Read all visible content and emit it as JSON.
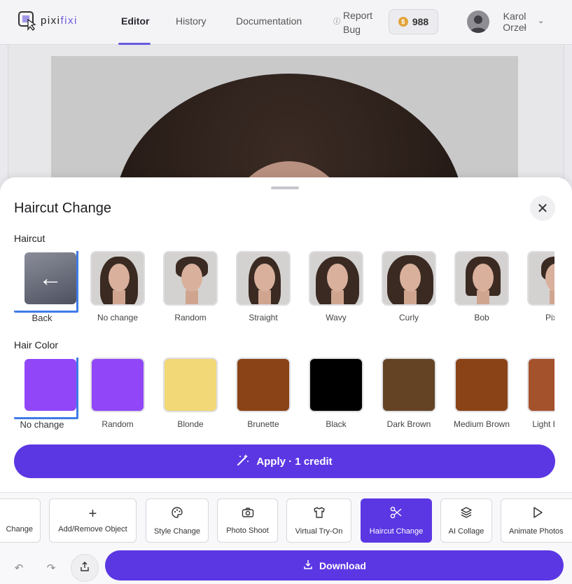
{
  "header": {
    "logo": {
      "part1": "pixi",
      "part2": "fixi"
    },
    "tabs": [
      {
        "label": "Editor",
        "active": true
      },
      {
        "label": "History",
        "active": false
      },
      {
        "label": "Documentation",
        "active": false
      }
    ],
    "report_bug": {
      "line1": "Report",
      "line2": "Bug"
    },
    "credits": "988",
    "user": {
      "first": "Karol",
      "last": "Orzeł"
    }
  },
  "sheet": {
    "title": "Haircut Change",
    "close_icon": "close-icon",
    "haircut": {
      "label": "Haircut",
      "options": [
        {
          "label": "Back",
          "icon": "arrow-left-icon",
          "selected": true
        },
        {
          "label": "No change"
        },
        {
          "label": "Random"
        },
        {
          "label": "Straight"
        },
        {
          "label": "Wavy"
        },
        {
          "label": "Curly"
        },
        {
          "label": "Bob"
        },
        {
          "label": "Pixie"
        }
      ]
    },
    "hair_color": {
      "label": "Hair Color",
      "options": [
        {
          "label": "No change",
          "color": "#9147f7",
          "selected": true
        },
        {
          "label": "Random",
          "color": "#9147f7"
        },
        {
          "label": "Blonde",
          "color": "#f2d876"
        },
        {
          "label": "Brunette",
          "color": "#8a4316"
        },
        {
          "label": "Black",
          "color": "#000000"
        },
        {
          "label": "Dark Brown",
          "color": "#634323"
        },
        {
          "label": "Medium Brown",
          "color": "#8a4316"
        },
        {
          "label": "Light Brown",
          "color": "#a4522c"
        }
      ]
    },
    "apply_label": "Apply · 1 credit"
  },
  "toolbar": {
    "tools": [
      {
        "label": "Change",
        "icon": ""
      },
      {
        "label": "Add/Remove Object",
        "icon": "plus-icon"
      },
      {
        "label": "Style Change",
        "icon": "palette-icon"
      },
      {
        "label": "Photo Shoot",
        "icon": "camera-icon"
      },
      {
        "label": "Virtual Try-On",
        "icon": "shirt-icon"
      },
      {
        "label": "Haircut Change",
        "icon": "scissors-icon",
        "active": true
      },
      {
        "label": "AI Collage",
        "icon": "layers-icon"
      },
      {
        "label": "Animate Photos",
        "icon": "play-icon"
      }
    ],
    "download_label": "Download"
  },
  "colors": {
    "accent": "#5b37e3",
    "selection": "#3e7be8",
    "coin": "#e2a43b"
  }
}
